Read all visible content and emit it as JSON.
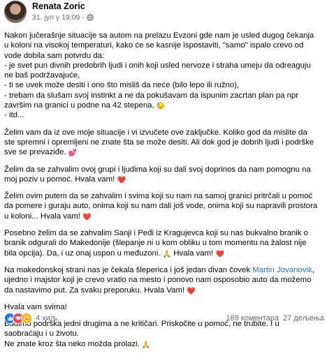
{
  "header": {
    "author": "Renata Zoric",
    "timestamp": "31. јул у 19:09",
    "separator": "·"
  },
  "body": {
    "p1": "Nakon jučerašnje situacije sa autom na prelazu Evzoni gde nam je usled dugog čekanja u koloni na visokoj temperaturi, kako će se kasnije ispostaviti, \"samo\" ispalo crevo od vode dobila sam potvrdu da:\n- je svet pun divnih predobrih ljudi i onih koji usled nervoze i straha umeju da odreaguju ne baš podržavajuće,\n- ti se uvek može desiti i ono što misliš da neće (bilo lepo ili ružno),\n- trebam da slušam svoj instinkt a ne da pokušavam da ispunim zacrtan plan pa npr završim na granici u podne na 42 stepena,",
    "p1_tail": "- itd...",
    "p2": "Želim vam da iz ove moje situacije i vi izvučete ove zaključke. Koliko god da mislite da ste spremni i opremljeni ne znate šta se može desiti. Ali dok god je dobrih ljudi i podrške sve se prevaziđe.",
    "p3": "Želim da se zahvalim ovoj grupi i ljudima koji su dali svoj doprinos da nam pomognu na moj poziv u pomoć. Hvala vam!",
    "p4": "Želim ovim putem da se zahvalim i svima koji su nam na samoj granici pritrčali u pomoć da pomere i guraju auto, onima koji su nam dali još vode, onima koji su napravili prostora u koloni... Hvala vam!",
    "p5": "Posebno želim da se zahvalim Sanji i Peđi iz Kragujevca koji su nas bukvalno branik o branik odgurali do Makedonije (šlepanje ni u kom obliku u tom momentu na žalost nije bila opcija). Da, i uz onaj uspon u međuzoni.",
    "p5_tail": "Hvala vam!",
    "p6_a": "Na makedonskoj strani nas je čekala šleperica i još jedan divan čovek ",
    "p6_link": "Martin Jovanovik",
    "p6_b": ", ujedno i majstor koji je crevo vratio na mesto i ponovo nam osposobio auto da možemo da nastavimo put. Za svaku preporuku. Hvala Vam!",
    "p7": "Hvala vam svima!",
    "p8": "Budimo podrška jedni drugima a ne kritičari. Priskočite u pomoć, ne trubite. I u saobraćaju i u životu.\nNe znate kroz šta neko možda prolazi."
  },
  "footer": {
    "reaction_count": "4 хиљ.",
    "comments": "169 коментара",
    "shares": "27 дељења"
  },
  "colors": {
    "link": "#216fdb",
    "meta": "#65676b",
    "like": "#1877f2",
    "love": "#f33e58",
    "care": "#f7b125"
  },
  "icons": [
    "globe-icon",
    "more-icon",
    "sweat-emoji",
    "heart-emoji",
    "pray-emoji",
    "like-reaction-icon",
    "love-reaction-icon",
    "care-reaction-icon"
  ]
}
